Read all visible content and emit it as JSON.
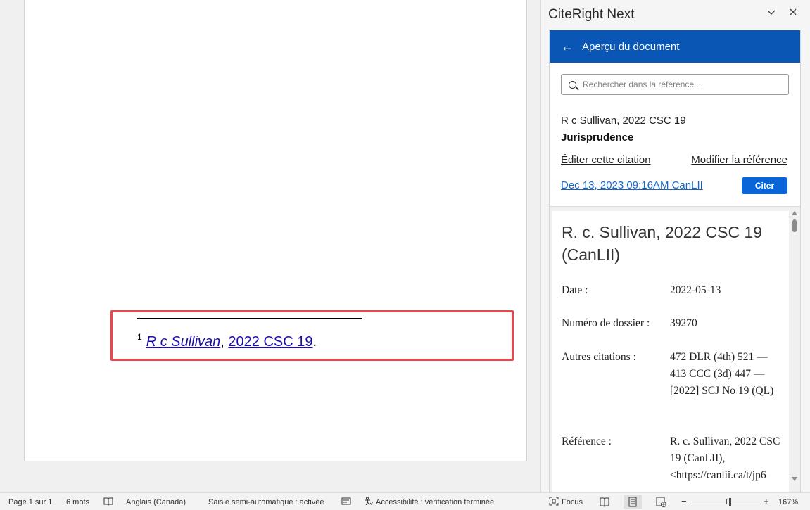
{
  "document": {
    "footnote_number": "1",
    "footnote_case_link": "R c Sullivan",
    "footnote_separator": ",",
    "footnote_citation_link": "2022 CSC 19",
    "footnote_end": "."
  },
  "pane": {
    "title": "CiteRight Next",
    "header": "Aperçu du document",
    "search_placeholder": "Rechercher dans la référence...",
    "reference_title": "R c Sullivan, 2022 CSC 19",
    "reference_type": "Jurisprudence",
    "edit_link": "Éditer cette citation",
    "modify_link": "Modifier la référence",
    "date_link": "Dec 13, 2023 09:16AM CanLII",
    "cite_button": "Citer",
    "preview": {
      "case_title": "R. c. Sullivan, 2022 CSC 19 (CanLII)",
      "date_label": "Date :",
      "date_value": "2022-05-13",
      "docket_label": "Numéro de dossier :",
      "docket_value": "39270",
      "other_label": "Autres citations :",
      "other_value": "472 DLR (4th) 521 — 413 CCC (3d) 447 — [2022] SCJ No 19 (QL)",
      "reference_label": "Référence :",
      "reference_value": "R. c. Sullivan, 2022 CSC 19 (CanLII), <https://canlii.ca/t/jp6"
    }
  },
  "statusbar": {
    "page": "Page 1 sur 1",
    "words": "6 mots",
    "language": "Anglais (Canada)",
    "autocorrect": "Saisie semi-automatique : activée",
    "accessibility": "Accessibilité : vérification terminée",
    "focus": "Focus",
    "zoom_minus": "−",
    "zoom_plus": "+",
    "zoom": "167%"
  }
}
